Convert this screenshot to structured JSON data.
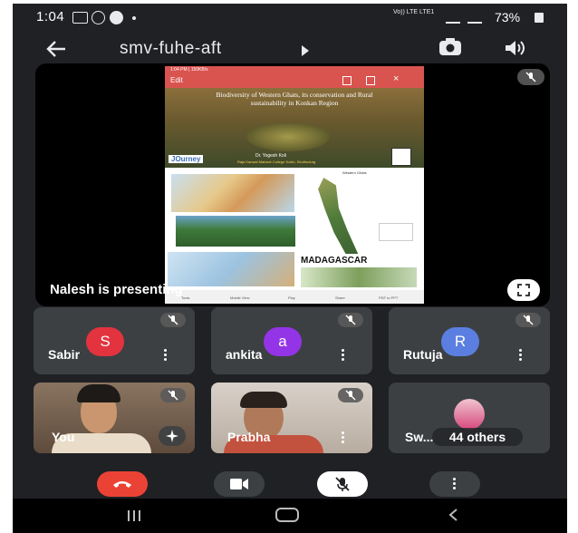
{
  "status_bar": {
    "time": "1:04",
    "battery": "73%",
    "network": "Vo)) LTE LTE1"
  },
  "top_bar": {
    "meeting_code": "smv-fuhe-aft"
  },
  "presentation": {
    "presenter_label": "Nalesh is presenting",
    "slide": {
      "topbar_text": "1:04 PM | 150KB/s",
      "menu_label": "Edit",
      "title": "Biodiversity of Western Ghats, its conservation and Rural sustainability in Konkan Region",
      "author": "Dr. Yogesh Koli",
      "college": "Raja Kanwal Mahavir College Kolsh, Sindhudurg",
      "brand": "JOurney",
      "map_title": "Western Ghats",
      "caption": "MADAGASCAR",
      "toolbar": [
        "Tools",
        "Mobile View",
        "Play",
        "Share",
        "PDF to PPT"
      ]
    }
  },
  "participants": [
    {
      "name": "Sabir",
      "initial": "S",
      "color": "#e2333f"
    },
    {
      "name": "ankita",
      "initial": "a",
      "color": "#9334e6"
    },
    {
      "name": "Rutuja",
      "initial": "R",
      "color": "#5b7fe0"
    },
    {
      "name": "You"
    },
    {
      "name": "Prabha"
    },
    {
      "name": "Sw...",
      "others_label": "44 others"
    }
  ],
  "colors": {
    "end_call": "#ea4335",
    "tile_bg": "#3c4043",
    "app_bg": "#202124"
  }
}
